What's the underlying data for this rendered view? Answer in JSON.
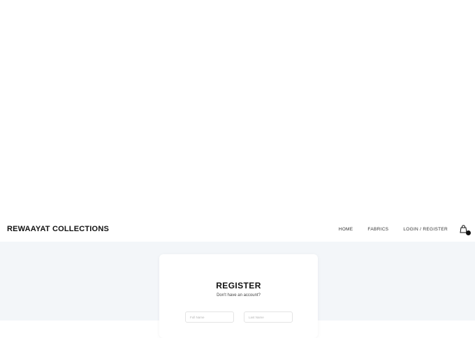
{
  "navbar": {
    "brand": "REWAAYAT COLLECTIONS",
    "links": [
      "HOME",
      "FABRICS",
      "LOGIN / REGISTER"
    ],
    "cart_icon": "shopping-bag-icon"
  },
  "register": {
    "title": "REGISTER",
    "subtitle": "Don't have an account?",
    "first_name_placeholder": "Full Name",
    "last_name_placeholder": "Last Name"
  },
  "colors": {
    "page_background": "#f3f6f9",
    "text_primary": "#111111",
    "card_background": "#ffffff"
  }
}
